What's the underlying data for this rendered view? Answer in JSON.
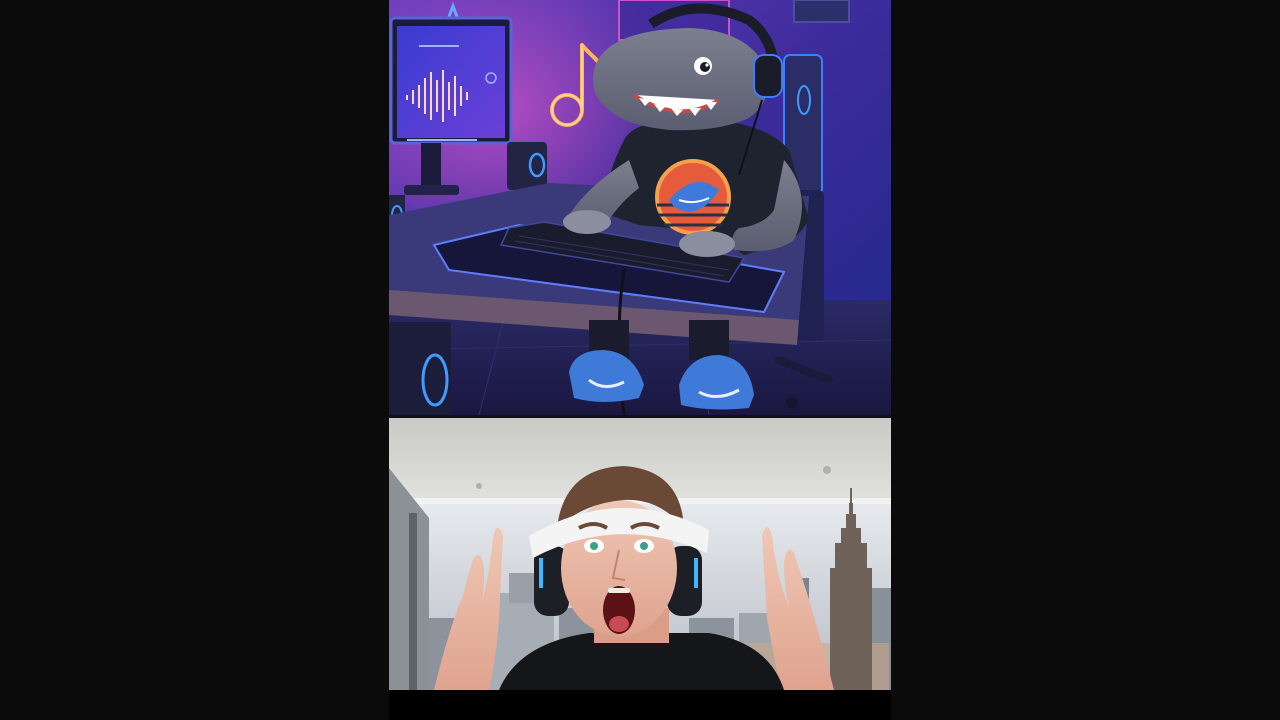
{
  "layout_mode": "vertical-split-video",
  "colors": {
    "letterbox": "#0b0b0c",
    "room_purple": "#3a2a8c",
    "neon_blue": "#3f7dff",
    "neon_pink": "#ff5fd2",
    "neon_orange": "#ffb35a",
    "sky": "#d9dee3"
  },
  "panels": [
    {
      "id": "top",
      "content": "illustration-shark-gamer"
    },
    {
      "id": "bottom",
      "content": "reaction-webcam"
    }
  ]
}
